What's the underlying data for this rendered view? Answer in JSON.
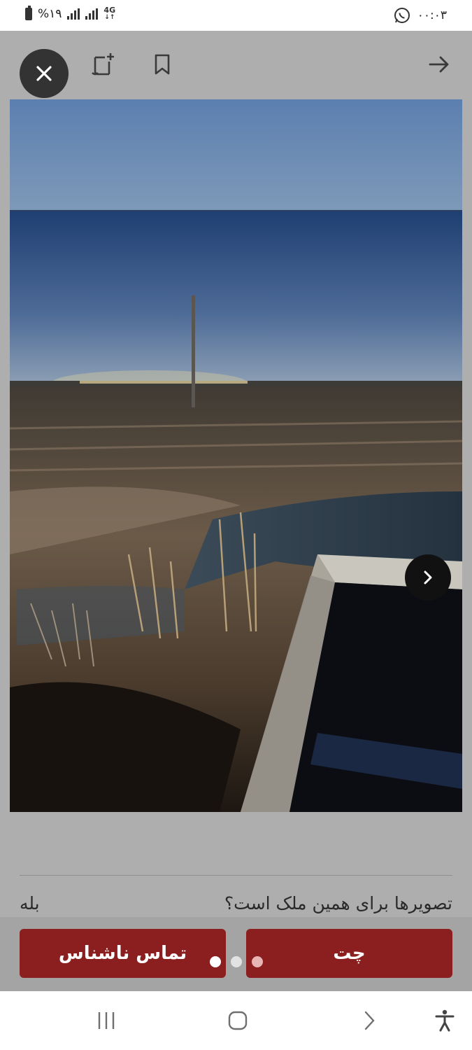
{
  "status_bar": {
    "battery_text": "%۱۹",
    "network": "4G",
    "time": "۰۰:۰۳",
    "icons": [
      "battery-icon",
      "signal-icon",
      "signal-icon",
      "network-4g-icon",
      "whatsapp-icon"
    ]
  },
  "toolbar": {
    "icons": [
      "close-icon",
      "add-note-icon",
      "bookmark-icon",
      "back-arrow-icon"
    ]
  },
  "gallery": {
    "next_icon": "chevron-right-icon",
    "dots_count": 3,
    "active_dot": 0
  },
  "question": {
    "text": "تصویرها برای همین ملک است؟",
    "answer": "بله"
  },
  "actions": {
    "anonymous_call_label": "تماس ناشناس",
    "chat_label": "چت",
    "accent_color": "#8b1f1f"
  },
  "nav_bar": {
    "icons": [
      "recent-apps-icon",
      "home-icon",
      "back-icon",
      "accessibility-icon"
    ]
  }
}
